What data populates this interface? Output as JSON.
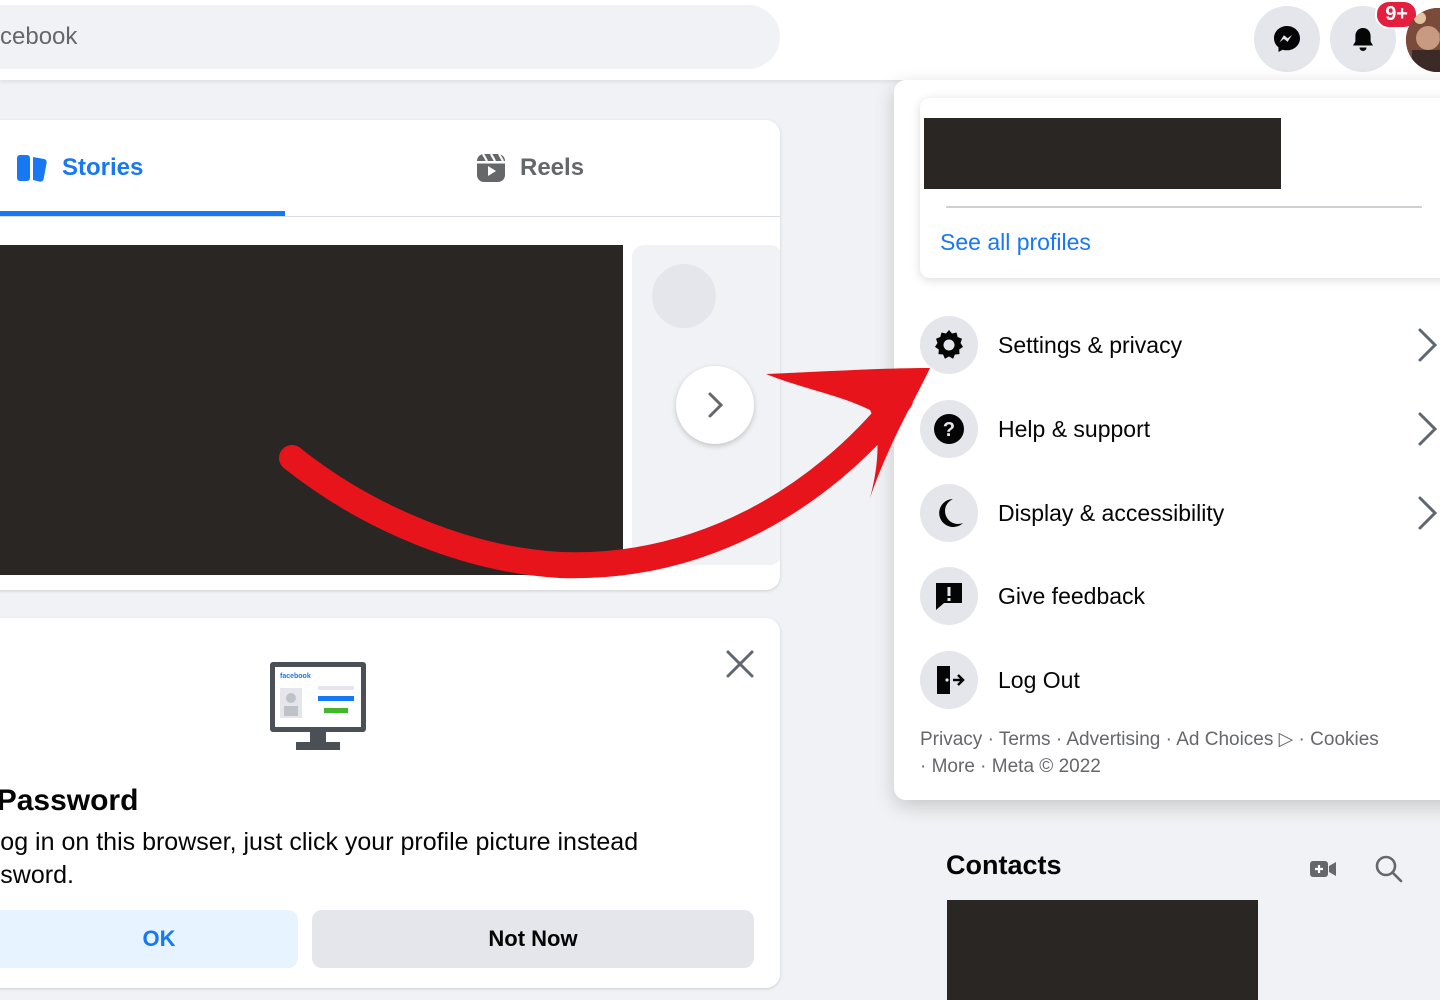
{
  "topbar": {
    "search_placeholder": "cebook",
    "notification_badge": "9+"
  },
  "stories": {
    "tab_stories": "Stories",
    "tab_reels": "Reels"
  },
  "password_card": {
    "title": "er Password",
    "text": "ou log in on this browser, just click your profile picture instead password.",
    "text_line1": "ou log in on this browser, just click your profile picture instead",
    "text_line2": "password.",
    "ok_label": "OK",
    "not_now_label": "Not Now",
    "illus_brand": "facebook"
  },
  "menu": {
    "see_all_profiles": "See all profiles",
    "items": [
      {
        "label": "Settings & privacy",
        "icon": "gear-icon",
        "chevron": true
      },
      {
        "label": "Help & support",
        "icon": "question-icon",
        "chevron": true
      },
      {
        "label": "Display & accessibility",
        "icon": "moon-icon",
        "chevron": true
      },
      {
        "label": "Give feedback",
        "icon": "feedback-icon",
        "chevron": false
      },
      {
        "label": "Log Out",
        "icon": "logout-icon",
        "chevron": false
      }
    ],
    "footer_line1": "Privacy · Terms · Advertising · Ad Choices ▷ · Cookies",
    "footer_line2": "· More · Meta © 2022"
  },
  "contacts": {
    "title": "Contacts"
  },
  "colors": {
    "accent": "#1877f2",
    "arrow": "#e8141c",
    "badge": "#e41e3f"
  }
}
